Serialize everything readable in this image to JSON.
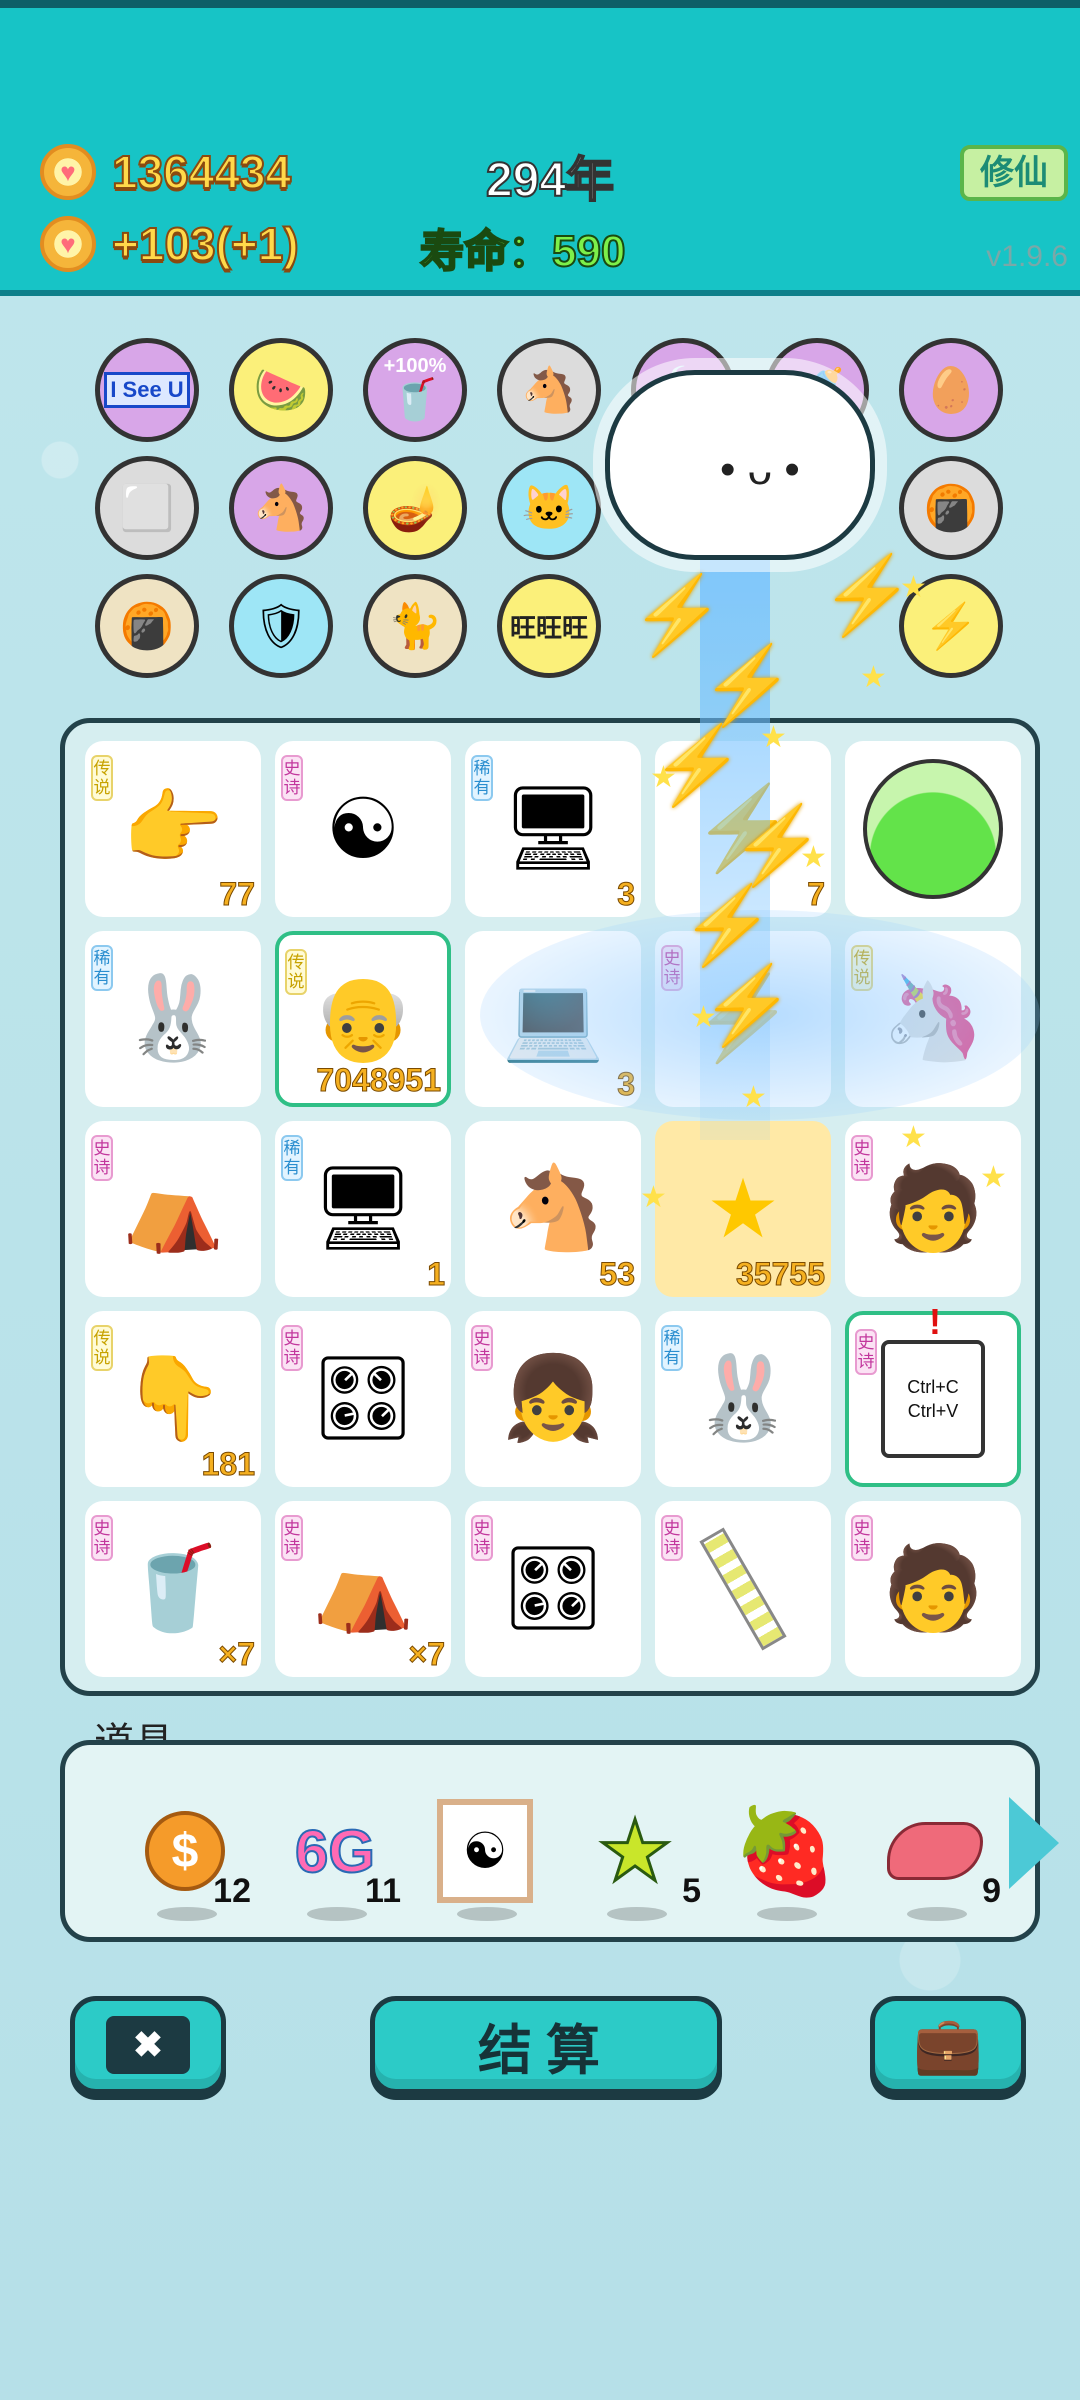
{
  "header": {
    "coins": "1364434",
    "income": "+103(+1)",
    "year": "294年",
    "lifespan": "寿命：590",
    "mode_button": "修仙",
    "version": "v1.9.6"
  },
  "badges": [
    {
      "icon": "I See U",
      "text": "I See U",
      "color": "purple"
    },
    {
      "icon": "fruit-basket",
      "color": "yellow"
    },
    {
      "icon": "milk-tea-100",
      "text": "+100%",
      "color": "purple"
    },
    {
      "icon": "horse-pair",
      "color": "gray"
    },
    {
      "icon": "leaf",
      "color": "purple"
    },
    {
      "icon": "breast-pump",
      "color": "purple"
    },
    {
      "icon": "gold-egg-sunglasses",
      "color": "purple"
    },
    {
      "icon": "tofu-blocks",
      "color": "gray"
    },
    {
      "icon": "horse-pair-2",
      "color": "purple"
    },
    {
      "icon": "magic-lamp",
      "color": "yellow"
    },
    {
      "icon": "cat-box",
      "color": "blue"
    },
    {
      "icon": "snack-bag",
      "color": "gray"
    },
    {
      "icon": "snack-bag-2",
      "color": "beige"
    },
    {
      "icon": "shield-wrench",
      "color": "blue"
    },
    {
      "icon": "cats-pair",
      "color": "beige"
    },
    {
      "icon": "wang-wang",
      "text": "旺旺旺",
      "color": "yellow"
    },
    {
      "icon": "lightning",
      "color": "yellow"
    }
  ],
  "tiles": [
    {
      "rarity": "传说",
      "icon": "hand-point",
      "count": "77"
    },
    {
      "rarity": "史诗",
      "icon": "bagua"
    },
    {
      "rarity": "稀有",
      "icon": "server-pc",
      "count": "3"
    },
    {
      "rarity": "",
      "icon": "lightning",
      "count": "7"
    },
    {
      "rarity": "",
      "icon": "green-slime-ball"
    },
    {
      "rarity": "稀有",
      "icon": "rabbit"
    },
    {
      "rarity": "传说",
      "icon": "bald-grandpa",
      "count": "7048951",
      "selected": true
    },
    {
      "rarity": "",
      "icon": "computer-monitor",
      "count": "3"
    },
    {
      "rarity": "史诗",
      "icon": "lightning"
    },
    {
      "rarity": "传说",
      "icon": "unicorn"
    },
    {
      "rarity": "史诗",
      "icon": "rabbit-tent"
    },
    {
      "rarity": "稀有",
      "icon": "server-pc",
      "count": "1"
    },
    {
      "rarity": "",
      "icon": "horse",
      "count": "53"
    },
    {
      "rarity": "",
      "icon": "stars-pile",
      "count": "35755"
    },
    {
      "rarity": "史诗",
      "icon": "green-hat-man"
    },
    {
      "rarity": "传说",
      "icon": "hand-point-down",
      "count": "181"
    },
    {
      "rarity": "史诗",
      "icon": "graphics-card"
    },
    {
      "rarity": "史诗",
      "icon": "girl-braids"
    },
    {
      "rarity": "稀有",
      "icon": "rabbit"
    },
    {
      "rarity": "史诗",
      "icon": "copy-paste",
      "text": "Ctrl+C\nCtrl+V",
      "selected": true
    },
    {
      "rarity": "史诗",
      "icon": "milk-tea-cup",
      "count": "×7"
    },
    {
      "rarity": "史诗",
      "icon": "rabbit-tent",
      "count": "×7"
    },
    {
      "rarity": "史诗",
      "icon": "graphics-card"
    },
    {
      "rarity": "史诗",
      "icon": "straw"
    },
    {
      "rarity": "史诗",
      "icon": "green-hat-man"
    }
  ],
  "props": {
    "label": "道具",
    "items": [
      {
        "icon": "dollar-coin",
        "count": "12"
      },
      {
        "icon": "6g-text",
        "text": "6G",
        "count": "11"
      },
      {
        "icon": "bagua-frame",
        "count": ""
      },
      {
        "icon": "star",
        "count": "5"
      },
      {
        "icon": "strawberry",
        "count": ""
      },
      {
        "icon": "liver",
        "count": "9"
      }
    ]
  },
  "buttons": {
    "close_icon": "✖",
    "settle": "结算",
    "bag_icon": "💼"
  }
}
